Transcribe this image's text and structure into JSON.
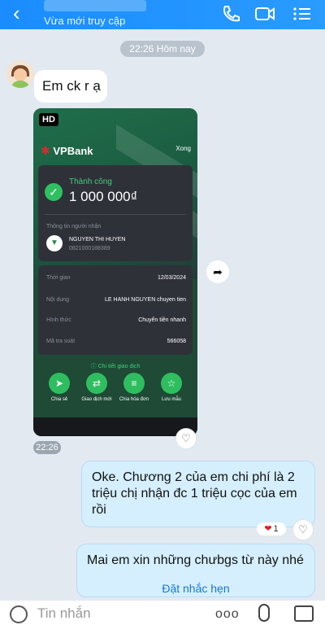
{
  "header": {
    "status": "Vừa mới truy cập",
    "icons": [
      "back-icon",
      "phone-icon",
      "video-icon",
      "menu-icon"
    ]
  },
  "time_divider": "22:26 Hôm nay",
  "messages": {
    "incoming_text": "Em ck r ạ",
    "screenshot": {
      "hd": "HD",
      "bank": "VPBank",
      "done": "Xong",
      "status": "Thành công",
      "amount": "1 000 000₫",
      "recipient_label": "Thông tin người nhận",
      "recipient_name": "NGUYEN THI HUYEN",
      "recipient_account": "0821000188389",
      "rows": [
        {
          "label": "Thời gian",
          "value": "12/03/2024"
        },
        {
          "label": "Nội dung",
          "value": "LE HANH NGUYEN chuyen tien"
        },
        {
          "label": "Hình thức",
          "value": "Chuyển tiền nhanh"
        },
        {
          "label": "Mã tra soát",
          "value": "566058"
        }
      ],
      "detail_link": "Chi tiết giao dịch",
      "actions": [
        "Chia sẻ",
        "Giao dịch mới",
        "Chia hóa đơn",
        "Lưu mẫu"
      ]
    },
    "image_time": "22:26",
    "outgoing_text": "Oke. Chương 2 của em chi phí là 2 triệu chị nhận đc 1 triệu cọc của em rồi",
    "reaction_count": "1",
    "outgoing_text2": "Mai em xin những chưbgs từ này nhé",
    "remind_label": "Đặt nhắc hẹn"
  },
  "input": {
    "placeholder": "Tin nhắn",
    "more": "ooo"
  }
}
